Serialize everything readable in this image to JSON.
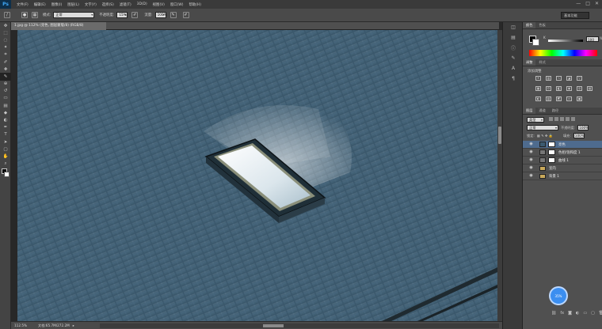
{
  "app": {
    "logo": "Ps"
  },
  "menubar": {
    "items": [
      "文件(F)",
      "编辑(E)",
      "图像(I)",
      "图层(L)",
      "文字(Y)",
      "选择(S)",
      "滤镜(T)",
      "3D(D)",
      "视图(V)",
      "窗口(W)",
      "帮助(H)"
    ],
    "window_controls": [
      "—",
      "□",
      "✕"
    ]
  },
  "options_bar": {
    "mode_label": "模式:",
    "mode_value": "正常",
    "opacity_label": "不透明度:",
    "opacity_value": "15%",
    "flow_label": "流量:",
    "flow_value": "100%",
    "workspace": "基本功能"
  },
  "document": {
    "tab_title": "1.jpg @ 112% (亮色, 图层蒙版/8) (RGB/8)",
    "zoom": "112.5%",
    "doc_info": "文档:65.7M/272.2M"
  },
  "panels": {
    "color_tabs": [
      "颜色",
      "色板"
    ],
    "color_channel": "K",
    "color_value": "100",
    "color_unit": "%",
    "adjust_tabs": [
      "调整",
      "样式"
    ],
    "adjust_title": "添加调整",
    "layers_tabs": [
      "图层",
      "通道",
      "路径"
    ],
    "filter_kind": "类型",
    "blend_mode": "正常",
    "opacity_label": "不透明度:",
    "opacity_value": "100%",
    "lock_label": "锁定:",
    "fill_label": "填充:",
    "fill_value": "100%",
    "layers": [
      {
        "name": "亮色",
        "type": "mask",
        "selected": true
      },
      {
        "name": "色相/饱和度 1",
        "type": "adjust",
        "selected": false
      },
      {
        "name": "曲线 1",
        "type": "adjust",
        "selected": false
      },
      {
        "name": "室内",
        "type": "group",
        "selected": false
      },
      {
        "name": "背景 1",
        "type": "group",
        "selected": false
      }
    ]
  },
  "floating_button": {
    "label": "35%"
  },
  "colors": {
    "canvas_roof": "#3c5a70",
    "selected_layer": "#4e6b8e",
    "fab": "#3b8ef0"
  }
}
